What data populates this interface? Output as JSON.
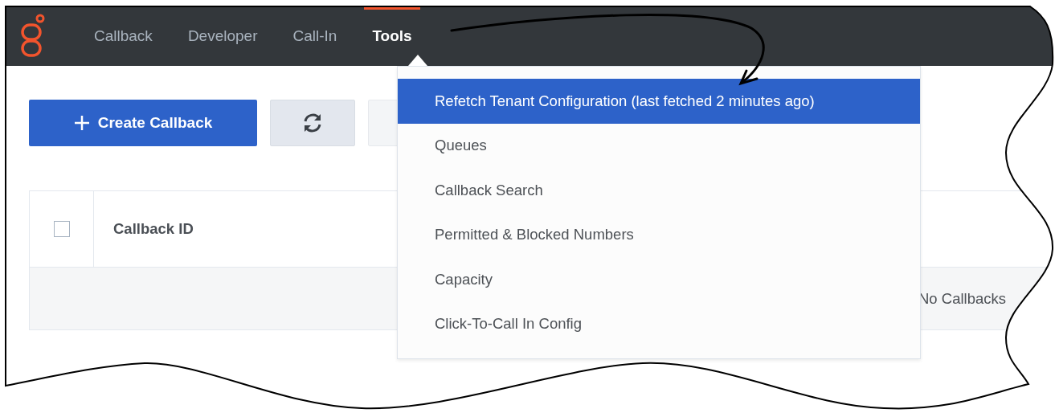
{
  "nav": {
    "items": [
      {
        "label": "Callback",
        "selected": false
      },
      {
        "label": "Developer",
        "selected": false
      },
      {
        "label": "Call-In",
        "selected": false
      },
      {
        "label": "Tools",
        "selected": true
      }
    ]
  },
  "toolbar": {
    "create_button": "Create Callback"
  },
  "table": {
    "header_checkbox": {
      "checked": false
    },
    "columns": [
      "Callback ID"
    ],
    "empty_message": "No Callbacks"
  },
  "tools_menu": {
    "items": [
      {
        "label": "Refetch Tenant Configuration (last fetched 2 minutes ago)",
        "selected": true
      },
      {
        "label": "Queues",
        "selected": false
      },
      {
        "label": "Callback Search",
        "selected": false
      },
      {
        "label": "Permitted & Blocked Numbers",
        "selected": false
      },
      {
        "label": "Capacity",
        "selected": false
      },
      {
        "label": "Click-To-Call In Config",
        "selected": false
      }
    ]
  }
}
